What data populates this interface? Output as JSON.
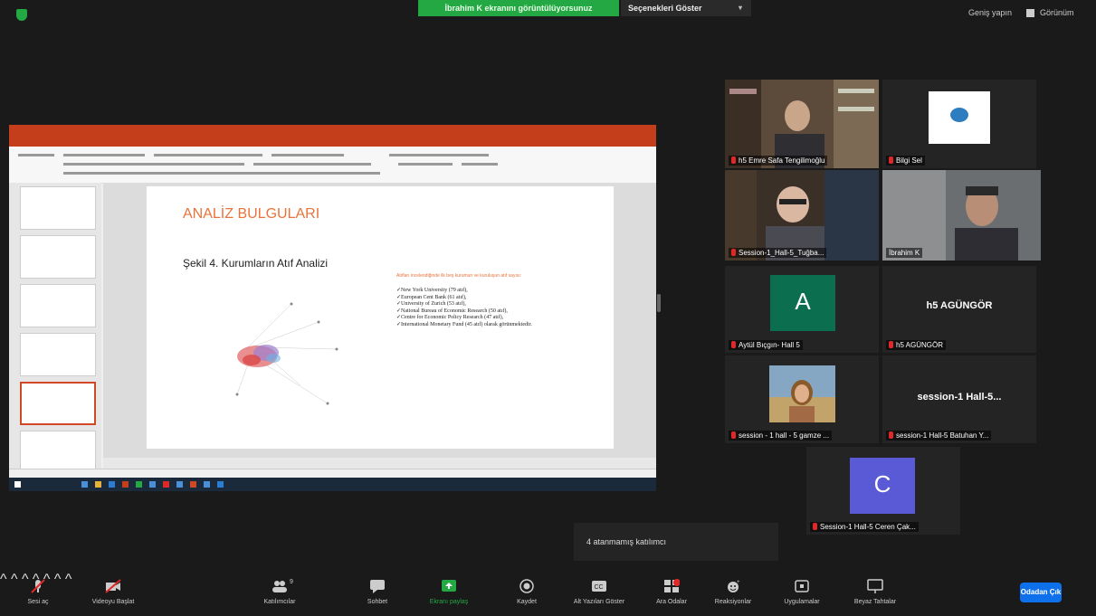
{
  "top": {
    "share_banner": "İbrahim K ekranını görüntülüyorsunuz",
    "view_options": "Seçenekleri Göster",
    "exit_fullscreen": "Geniş yapın",
    "view_mode": "Görünüm"
  },
  "slide": {
    "title": "ANALİZ BULGULARI",
    "subtitle": "Şekil 4. Kurumların Atıf Analizi",
    "note": "Atıfları incelendiğinde ilk beş kurumun ve kuruluşun atıf sayısı:",
    "items": [
      "New York University (79 atıf),",
      "European Cent Bank (61 atıf),",
      "University of Zurich (53 atıf),",
      "National Bureau of Economic Research (50 atıf),",
      "Centre for Economic Policy Research (47 atıf),",
      "International Monetary Fund (45 atıf) olarak görünmektedir."
    ]
  },
  "participants": [
    {
      "name": "h5 Emre Safa Tengilimoğlu",
      "type": "video"
    },
    {
      "name": "Bilgi Sel",
      "type": "logo"
    },
    {
      "name": "Session-1_Hall-5_Tuğba...",
      "type": "video"
    },
    {
      "name": "İbrahim K",
      "type": "video"
    },
    {
      "name": "Aytül Bıçgın- Hall 5",
      "type": "letter",
      "letter": "A",
      "color": "#0b6e4f"
    },
    {
      "name": "h5 AGÜNGÖR",
      "type": "name",
      "display": "h5 AGÜNGÖR"
    },
    {
      "name": "session - 1 hall - 5 gamze ...",
      "type": "video"
    },
    {
      "name": "session-1 Hall-5 Batuhan Y...",
      "type": "name",
      "display": "session-1 Hall-5..."
    },
    {
      "name": "Session-1 Hall-5 Ceren Çak...",
      "type": "letter",
      "letter": "C",
      "color": "#5a5ad6"
    }
  ],
  "toast": "4 atanmamış katılımcı",
  "toolbar": {
    "unmute": "Sesi aç",
    "start_video": "Videoyu Başlat",
    "participants": "Katılımcılar",
    "participants_count": "9",
    "chat": "Sohbet",
    "share_screen": "Ekranı paylaş",
    "record": "Kaydet",
    "captions": "Alt Yazıları Göster",
    "breakout": "Ara Odalar",
    "reactions": "Reaksiyonlar",
    "apps": "Uygulamalar",
    "whiteboard": "Beyaz Tahtalar",
    "leave": "Odadan Çık"
  },
  "colors": {
    "share_green": "#23a844",
    "leave_blue": "#0e71eb",
    "active_speaker": "#c5d43a",
    "powerpoint_red": "#c43e1c",
    "slide_title_orange": "#e8743b"
  }
}
